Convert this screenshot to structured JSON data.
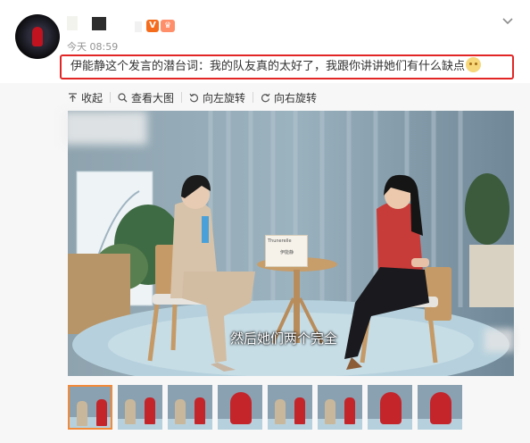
{
  "post": {
    "time": "今天 08:59",
    "text": "伊能静这个发言的潜台词：我的队友真的太好了，我跟你讲讲她们有什么缺点",
    "badge_v": "V"
  },
  "toolbar": {
    "collapse": "收起",
    "view_large": "查看大图",
    "rotate_left": "向左旋转",
    "rotate_right": "向右旋转"
  },
  "image": {
    "subtitle": "然后她们两个完全",
    "card_line1": "Thunerelle",
    "card_line2": "伊能静"
  },
  "thumbnails": {
    "count": 9,
    "active_index": 0
  },
  "colors": {
    "highlight_border": "#e22626",
    "thumb_active": "#f28a3a",
    "verified": "#f56c1c"
  },
  "icons": [
    "collapse-icon",
    "zoom-icon",
    "rotate-left-icon",
    "rotate-right-icon",
    "chevron-down-icon"
  ]
}
